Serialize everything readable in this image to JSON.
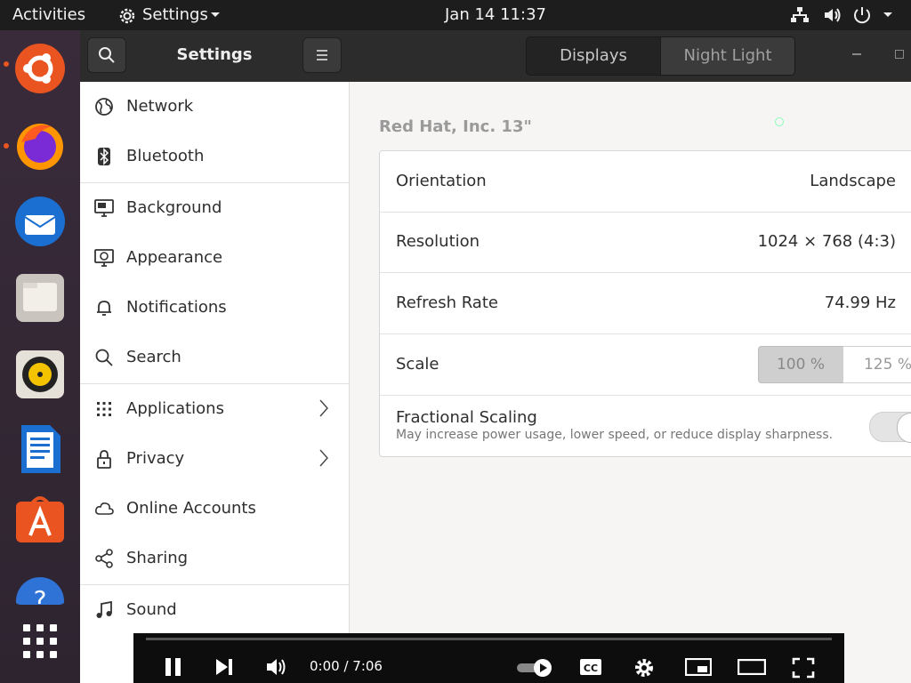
{
  "topbar": {
    "activities": "Activities",
    "app_menu": "Settings",
    "clock": "Jan 14  11:37"
  },
  "dock": {
    "items": [
      {
        "name": "ubuntu"
      },
      {
        "name": "firefox"
      },
      {
        "name": "thunderbird"
      },
      {
        "name": "files"
      },
      {
        "name": "rhythmbox"
      },
      {
        "name": "libreoffice-writer"
      },
      {
        "name": "ubuntu-software"
      },
      {
        "name": "help"
      },
      {
        "name": "show-applications"
      }
    ]
  },
  "sidebar_header": {
    "title": "Settings"
  },
  "tabs": [
    {
      "label": "Displays",
      "active": true
    },
    {
      "label": "Night Light",
      "active": false
    }
  ],
  "sidebar": {
    "items": [
      {
        "label": "Network",
        "icon": "globe-icon"
      },
      {
        "label": "Bluetooth",
        "icon": "bluetooth-icon"
      },
      {
        "label": "Background",
        "icon": "monitor-icon"
      },
      {
        "label": "Appearance",
        "icon": "appearance-icon"
      },
      {
        "label": "Notifications",
        "icon": "bell-icon"
      },
      {
        "label": "Search",
        "icon": "search-icon"
      },
      {
        "label": "Applications",
        "icon": "grid-icon"
      },
      {
        "label": "Privacy",
        "icon": "lock-icon"
      },
      {
        "label": "Online Accounts",
        "icon": "cloud-icon"
      },
      {
        "label": "Sharing",
        "icon": "share-icon"
      },
      {
        "label": "Sound",
        "icon": "music-icon"
      }
    ]
  },
  "display": {
    "monitor_name": "Red Hat, Inc. 13\"",
    "orientation_label": "Orientation",
    "orientation_value": "Landscape",
    "resolution_label": "Resolution",
    "resolution_value": "1024 × 768 (4:3)",
    "refresh_label": "Refresh Rate",
    "refresh_value": "74.99 Hz",
    "scale_label": "Scale",
    "scale_options": [
      "100 %",
      "125 %"
    ],
    "scale_selected": "100 %",
    "fractional_label": "Fractional Scaling",
    "fractional_desc": "May increase power usage, lower speed, or reduce display sharpness.",
    "fractional_enabled": false
  },
  "video_player": {
    "time": "0:00 / 7:06",
    "progress": 0
  },
  "colors": {
    "accent": "#e95420",
    "header_bg": "#2c2c2c",
    "topbar_bg": "#1d1d1d"
  }
}
